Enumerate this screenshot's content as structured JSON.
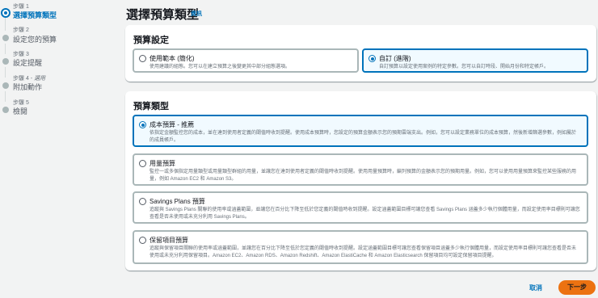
{
  "steps": [
    {
      "number": "步驟 1",
      "optional": "",
      "label": "選擇預算類型",
      "active": true
    },
    {
      "number": "步驟 2",
      "optional": "",
      "label": "設定您的預算",
      "active": false
    },
    {
      "number": "步驟 3",
      "optional": "",
      "label": "設定提醒",
      "active": false
    },
    {
      "number": "步驟 4 - ",
      "optional": "選用",
      "label": "附加動作",
      "active": false
    },
    {
      "number": "步驟 5",
      "optional": "",
      "label": "檢閱",
      "active": false
    }
  ],
  "page": {
    "title": "選擇預算類型",
    "info_link": "資訊"
  },
  "budget_setup": {
    "title": "預算設定",
    "options": [
      {
        "title": "使用範本 (簡化)",
        "description": "使用建議的組態。您可以在建立預算之後變更其中部分組態選項。",
        "selected": false
      },
      {
        "title": "自訂 (進階)",
        "description": "自訂預算以設定使用案例的特定參數。您可以自訂時段、開始月份和特定帳戶。",
        "selected": true
      }
    ]
  },
  "budget_type": {
    "title": "預算類型",
    "options": [
      {
        "title": "成本預算 - 推薦",
        "description": "依指定金額監控您的成本，並在達到使用者定義的閾值時收到提醒。使用成本預算時，您設定的預算金額表示您的預期雲端支出。例如，您可以設定業務單位的成本預算，然後新增篩選參數，例如屬於的成員帳戶。",
        "selected": true
      },
      {
        "title": "用量預算",
        "description": "監控一或多個指定用量類型或用量類型群組的用量，並讓您在達到使用者定義的閾值時收到提醒。使用用量預算時，編列預算的金額表示您的預期用量。例如，您可以使用用量預算來監控某些服務的用量，例如 Amazon EC2 和 Amazon S3。",
        "selected": false
      },
      {
        "title": "Savings Plans 預算",
        "description": "追蹤與 Savings Plans 關聯的使用率或涵蓋範圍，並讓您在百分比下降至低於您定義的閾值時收到提醒。設定涵蓋範圍目標可讓您查看 Savings Plans 涵蓋多少執行個體用量，而設定使用率目標則可讓您查看是否未使用或未充分利用 Savings Plans。",
        "selected": false
      },
      {
        "title": "保留項目預算",
        "description": "追蹤與保留項目關聯的使用率或涵蓋範圍，並讓您在百分比下降至低於您定義的閾值時收到提醒。設定涵蓋範圍目標可讓您查看保留項目涵蓋多少執行個體用量，而設定使用率目標則可讓您查看是否未使用或未充分利用保留項目。Amazon EC2、Amazon RDS、Amazon Redshift、Amazon ElastiCache 和 Amazon Elasticsearch 保留項目均可設定保留項目提醒。",
        "selected": false
      }
    ]
  },
  "footer": {
    "cancel_label": "取消",
    "next_label": "下一步"
  },
  "colors": {
    "accent": "#0073bb",
    "primary_button": "#ec7211",
    "background": "#f2f3f3"
  }
}
